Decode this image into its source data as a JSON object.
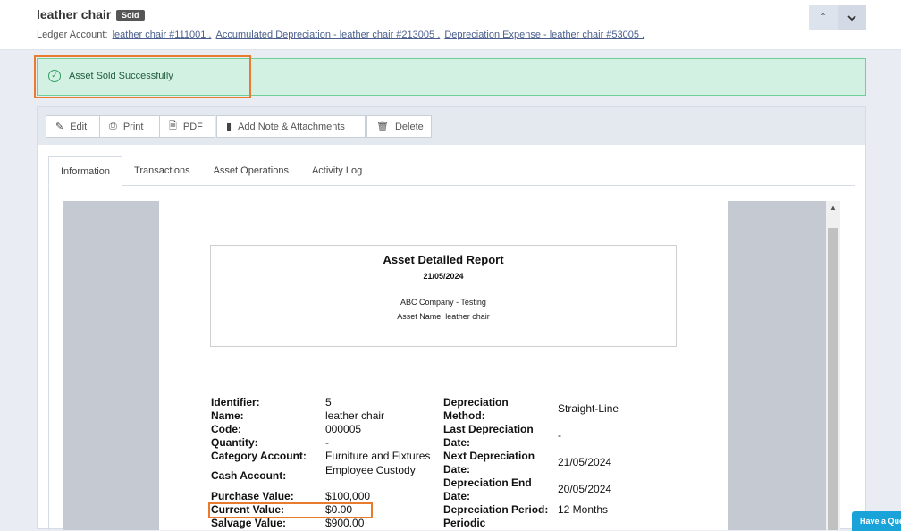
{
  "header": {
    "title": "leather chair",
    "status_badge": "Sold",
    "ledger_label": "Ledger Account:",
    "ledger_links": [
      "leather chair #111001 ,",
      "Accumulated Depreciation - leather chair #213005 ,",
      "Depreciation Expense - leather chair #53005 ,"
    ]
  },
  "alert": {
    "message": "Asset Sold Successfully"
  },
  "toolbar": {
    "edit": "Edit",
    "print": "Print",
    "pdf": "PDF",
    "add_note": "Add Note & Attachments",
    "delete": "Delete"
  },
  "tabs": [
    "Information",
    "Transactions",
    "Asset Operations",
    "Activity Log"
  ],
  "report": {
    "title": "Asset Detailed Report",
    "date": "21/05/2024",
    "company": "ABC Company - Testing",
    "asset_name": "Asset Name: leather chair",
    "left_fields": [
      {
        "label": "Identifier:",
        "value": "5"
      },
      {
        "label": "Name:",
        "value": "leather chair"
      },
      {
        "label": "Code:",
        "value": "000005"
      },
      {
        "label": "Quantity:",
        "value": "-"
      },
      {
        "label": "Category Account:",
        "value": "Furniture and Fixtures"
      },
      {
        "label": "Cash Account:",
        "value": "Employee Custody"
      },
      {
        "label": "Purchase Value:",
        "value": "$100,000"
      },
      {
        "label": "Current Value:",
        "value": "$0.00"
      },
      {
        "label": "Salvage Value:",
        "value": "$900.00"
      }
    ],
    "right_fields": [
      {
        "label_1": "Depreciation",
        "label_2": "Method:",
        "value": "Straight-Line"
      },
      {
        "label_1": "Last Depreciation",
        "label_2": "Date:",
        "value": "-"
      },
      {
        "label_1": "Next Depreciation",
        "label_2": "Date:",
        "value": "21/05/2024"
      },
      {
        "label_1": "Depreciation End",
        "label_2": "Date:",
        "value": "20/05/2024"
      },
      {
        "label_1": "Depreciation Period:",
        "value": "12 Months"
      },
      {
        "label_1": "Periodic"
      }
    ]
  },
  "quick_help": "Have a Question?"
}
